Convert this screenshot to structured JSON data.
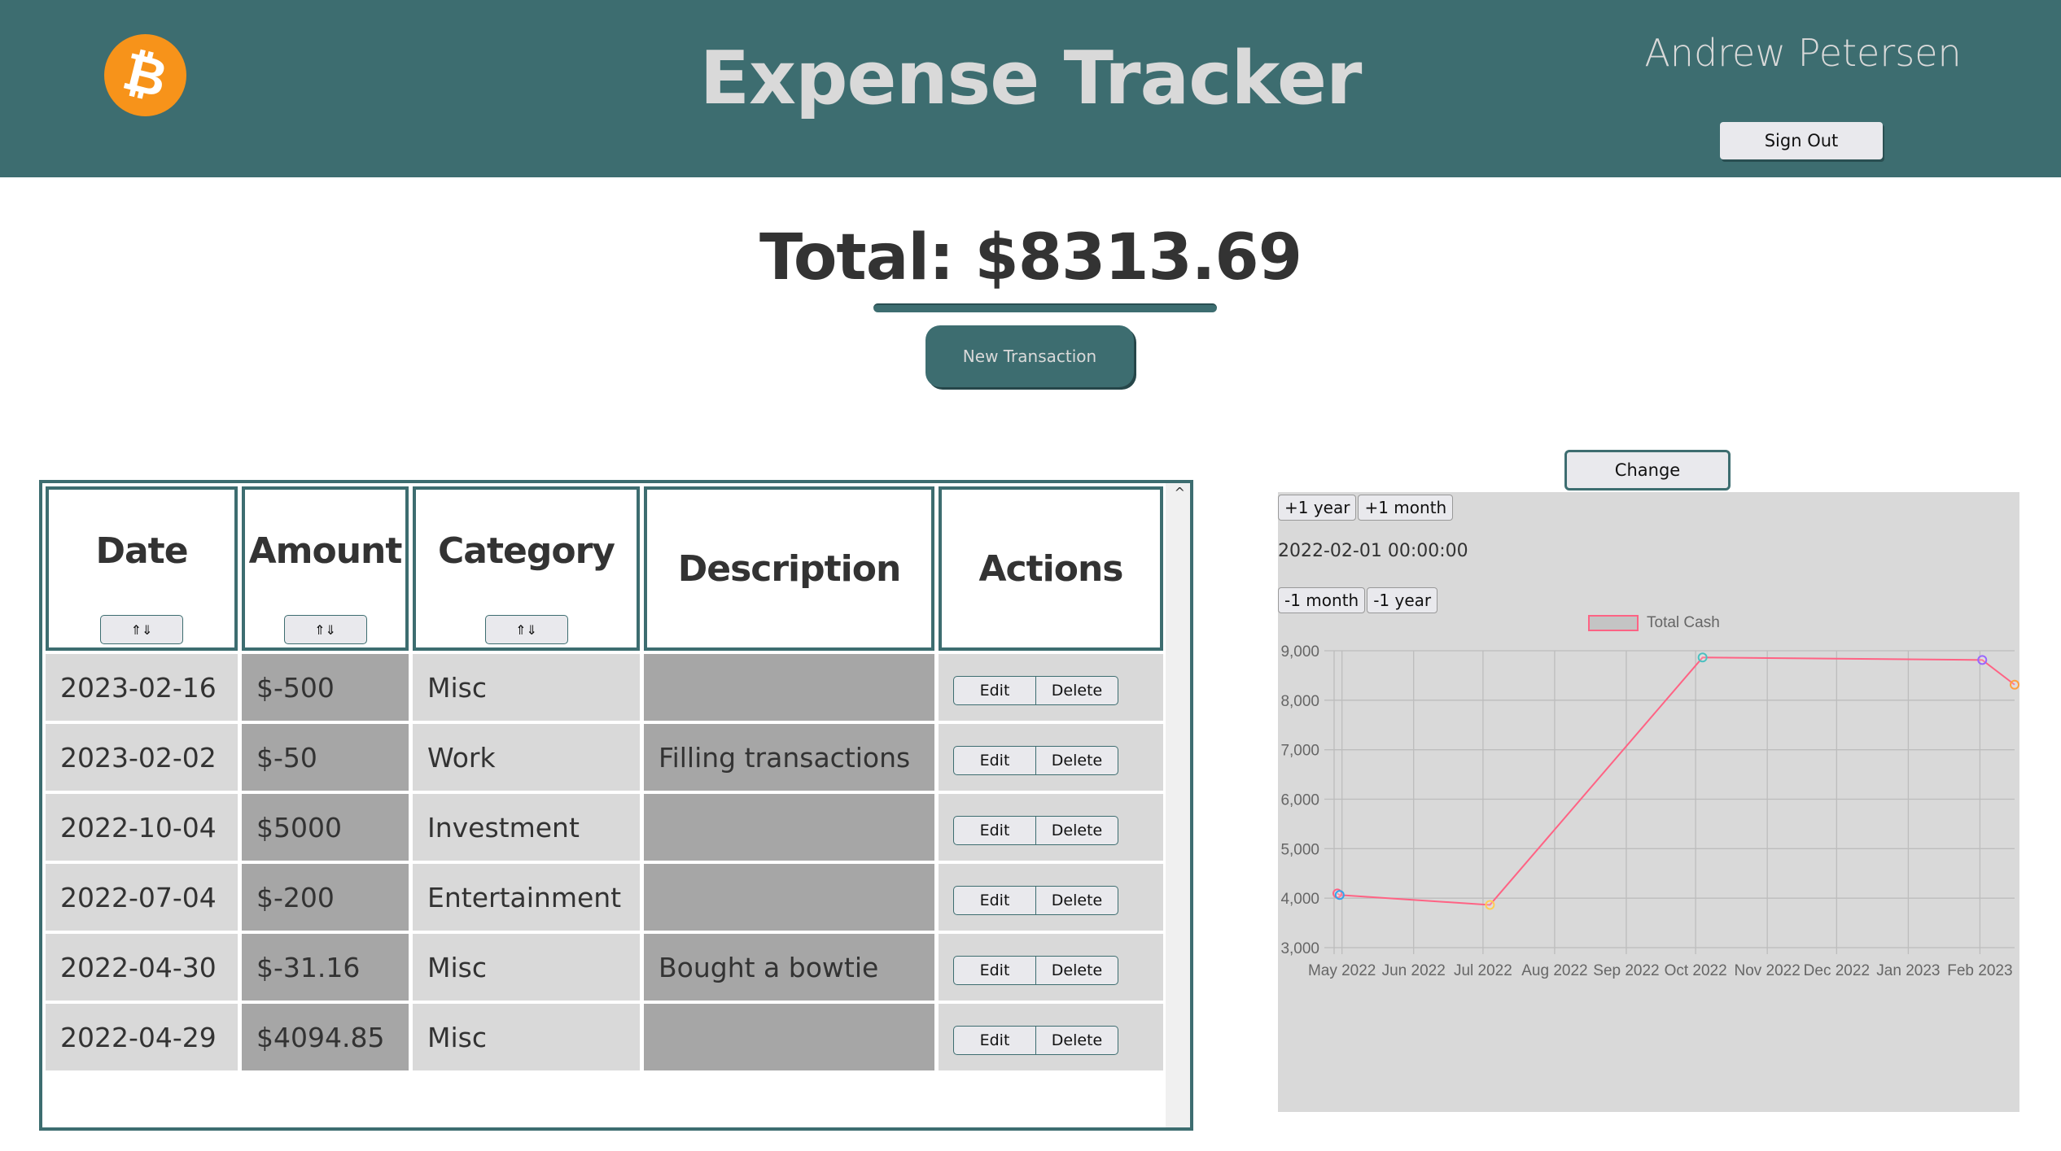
{
  "header": {
    "logo_icon": "bitcoin-icon",
    "logo_glyph": "₿",
    "title": "Expense Tracker",
    "user_name": "Andrew Petersen",
    "sign_out_label": "Sign Out"
  },
  "summary": {
    "total_text": "Total: $8313.69",
    "new_transaction_label": "New Transaction"
  },
  "table": {
    "columns": [
      {
        "label": "Date",
        "sortable": true
      },
      {
        "label": "Amount",
        "sortable": true
      },
      {
        "label": "Category",
        "sortable": true
      },
      {
        "label": "Description",
        "sortable": false
      },
      {
        "label": "Actions",
        "sortable": false
      }
    ],
    "sort_glyph": "⇑⇓",
    "edit_label": "Edit",
    "delete_label": "Delete",
    "rows": [
      {
        "date": "2023-02-16",
        "amount": "$-500",
        "category": "Misc",
        "description": ""
      },
      {
        "date": "2023-02-02",
        "amount": "$-50",
        "category": "Work",
        "description": "Filling transactions"
      },
      {
        "date": "2022-10-04",
        "amount": "$5000",
        "category": "Investment",
        "description": ""
      },
      {
        "date": "2022-07-04",
        "amount": "$-200",
        "category": "Entertainment",
        "description": ""
      },
      {
        "date": "2022-04-30",
        "amount": "$-31.16",
        "category": "Misc",
        "description": "Bought a bowtie"
      },
      {
        "date": "2022-04-29",
        "amount": "$4094.85",
        "category": "Misc",
        "description": ""
      }
    ],
    "scroll_up_glyph": "^"
  },
  "chart_panel": {
    "change_label": "Change",
    "plus_year_label": "+1 year",
    "plus_month_label": "+1 month",
    "current_date": "2022-02-01 00:00:00",
    "minus_month_label": "-1 month",
    "minus_year_label": "-1 year"
  },
  "chart_data": {
    "type": "line",
    "title": "",
    "legend": [
      "Total Cash"
    ],
    "legend_position": "top",
    "xlabel": "",
    "ylabel": "",
    "ylim": [
      3000,
      9000
    ],
    "yticks": [
      3000,
      4000,
      5000,
      6000,
      7000,
      8000,
      9000
    ],
    "ytick_labels": [
      "3,000",
      "4,000",
      "5,000",
      "6,000",
      "7,000",
      "8,000",
      "9,000"
    ],
    "xticks": [
      "May 2022",
      "Jun 2022",
      "Jul 2022",
      "Aug 2022",
      "Sep 2022",
      "Oct 2022",
      "Nov 2022",
      "Dec 2022",
      "Jan 2023",
      "Feb 2023"
    ],
    "xrange": [
      "2022-04-29",
      "2023-02-16"
    ],
    "grid": true,
    "line_color": "#ff6384",
    "series": [
      {
        "name": "Total Cash",
        "x": [
          "2022-04-29",
          "2022-04-30",
          "2022-07-04",
          "2022-10-04",
          "2023-02-02",
          "2023-02-16"
        ],
        "values": [
          4094.85,
          4063.69,
          3863.69,
          8863.69,
          8813.69,
          8313.69
        ],
        "point_colors": [
          "#ff6384",
          "#36a2eb",
          "#ffcd56",
          "#4bc0c0",
          "#9966ff",
          "#ff9f40"
        ]
      }
    ]
  }
}
